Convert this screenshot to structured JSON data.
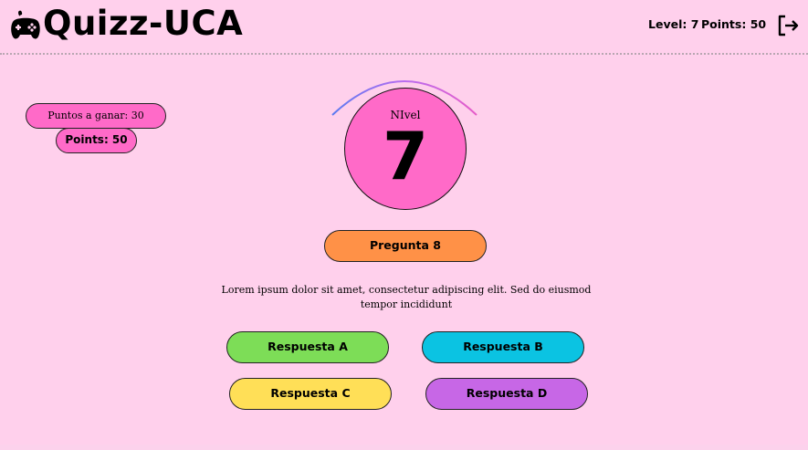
{
  "header": {
    "logo_icon": "gamepad-icon",
    "title": "Quizz-UCA",
    "level_text": "Level: 7",
    "points_text": "Points: 50",
    "logout_icon": "logout-icon"
  },
  "badges": {
    "puntos_a_ganar": "Puntos a ganar: 30",
    "points": "Points: 50"
  },
  "level": {
    "label": "NIvel",
    "value": "7"
  },
  "question": {
    "button_label": "Pregunta 8",
    "text": "Lorem ipsum dolor sit amet, consectetur adipiscing elit. Sed do eiusmod tempor incididunt"
  },
  "answers": [
    {
      "label": "Respuesta A",
      "color": "#7ddd57"
    },
    {
      "label": "Respuesta B",
      "color": "#0bc3e2"
    },
    {
      "label": "Respuesta C",
      "color": "#ffdf57"
    },
    {
      "label": "Respuesta D",
      "color": "#c767e6"
    }
  ],
  "colors": {
    "background": "#ffd0ec",
    "accent_pink": "#ff6ac8",
    "question_orange": "#ff9147"
  }
}
